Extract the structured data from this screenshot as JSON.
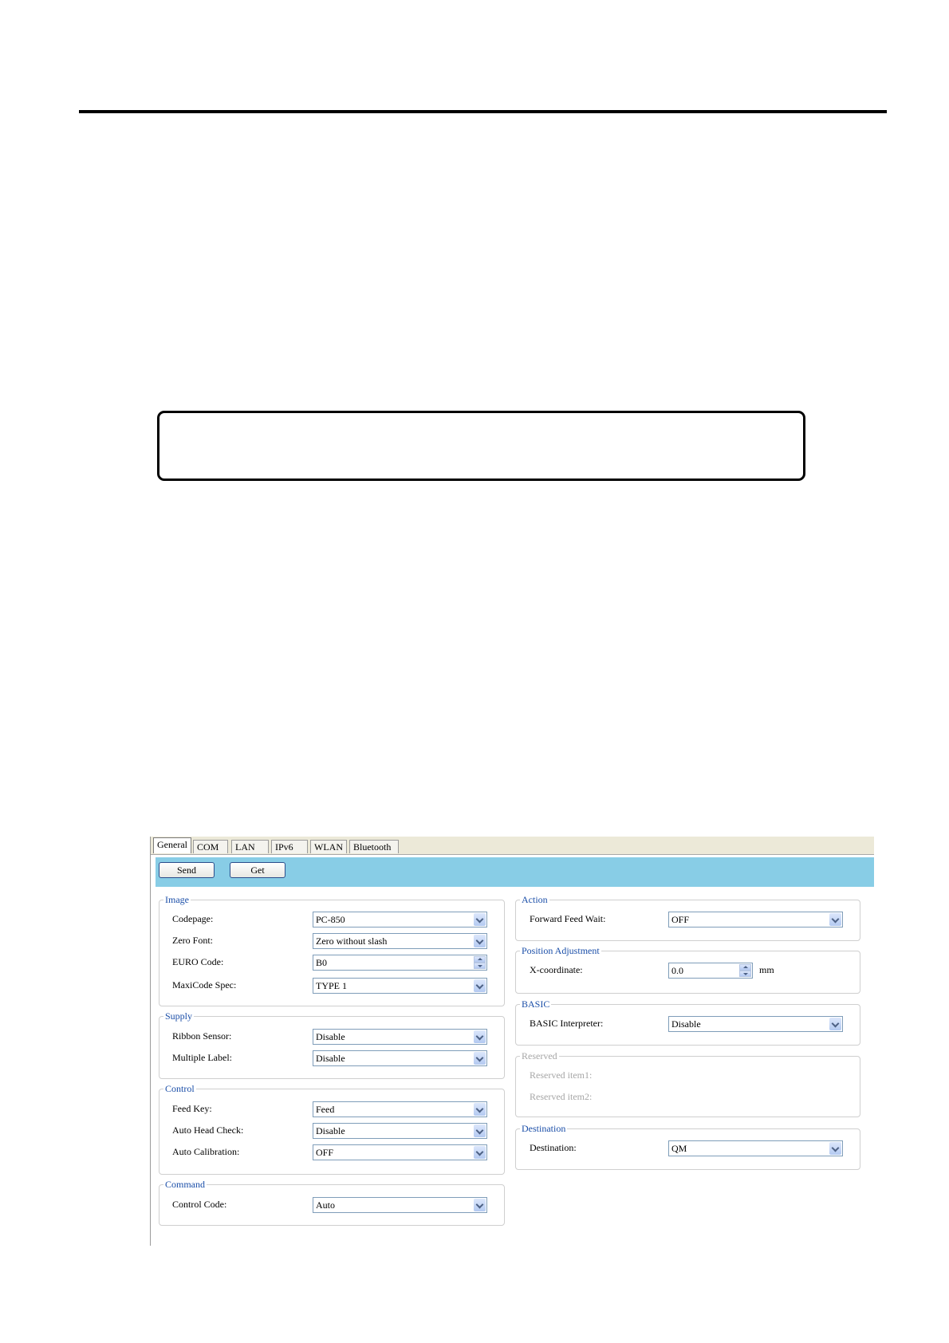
{
  "screenshot": {
    "tabs": [
      "General",
      "COM",
      "LAN",
      "IPv6",
      "WLAN",
      "Bluetooth"
    ],
    "active_tab": "General",
    "toolbar": {
      "send_label": "Send",
      "get_label": "Get"
    },
    "image": {
      "title": "Image",
      "codepage": {
        "label": "Codepage:",
        "value": "PC-850"
      },
      "zero_font": {
        "label": "Zero Font:",
        "value": "Zero without slash"
      },
      "euro_code": {
        "label": "EURO Code:",
        "value": "B0"
      },
      "maxicode_spec": {
        "label": "MaxiCode Spec:",
        "value": "TYPE 1"
      }
    },
    "supply": {
      "title": "Supply",
      "ribbon_sensor": {
        "label": "Ribbon Sensor:",
        "value": "Disable"
      },
      "multiple_label": {
        "label": "Multiple Label:",
        "value": "Disable"
      }
    },
    "control": {
      "title": "Control",
      "feed_key": {
        "label": "Feed Key:",
        "value": "Feed"
      },
      "auto_head_check": {
        "label": "Auto Head Check:",
        "value": "Disable"
      },
      "auto_calibration": {
        "label": "Auto Calibration:",
        "value": "OFF"
      }
    },
    "command": {
      "title": "Command",
      "control_code": {
        "label": "Control Code:",
        "value": "Auto"
      }
    },
    "action": {
      "title": "Action",
      "forward_feed_wait": {
        "label": "Forward Feed Wait:",
        "value": "OFF"
      }
    },
    "position_adjustment": {
      "title": "Position Adjustment",
      "x_coordinate": {
        "label": "X-coordinate:",
        "value": "0.0",
        "unit": "mm"
      }
    },
    "basic": {
      "title": "BASIC",
      "interpreter": {
        "label": "BASIC Interpreter:",
        "value": "Disable"
      }
    },
    "reserved": {
      "title": "Reserved",
      "item1": "Reserved item1:",
      "item2": "Reserved item2:"
    },
    "destination": {
      "title": "Destination",
      "destination": {
        "label": "Destination:",
        "value": "QM"
      }
    }
  }
}
